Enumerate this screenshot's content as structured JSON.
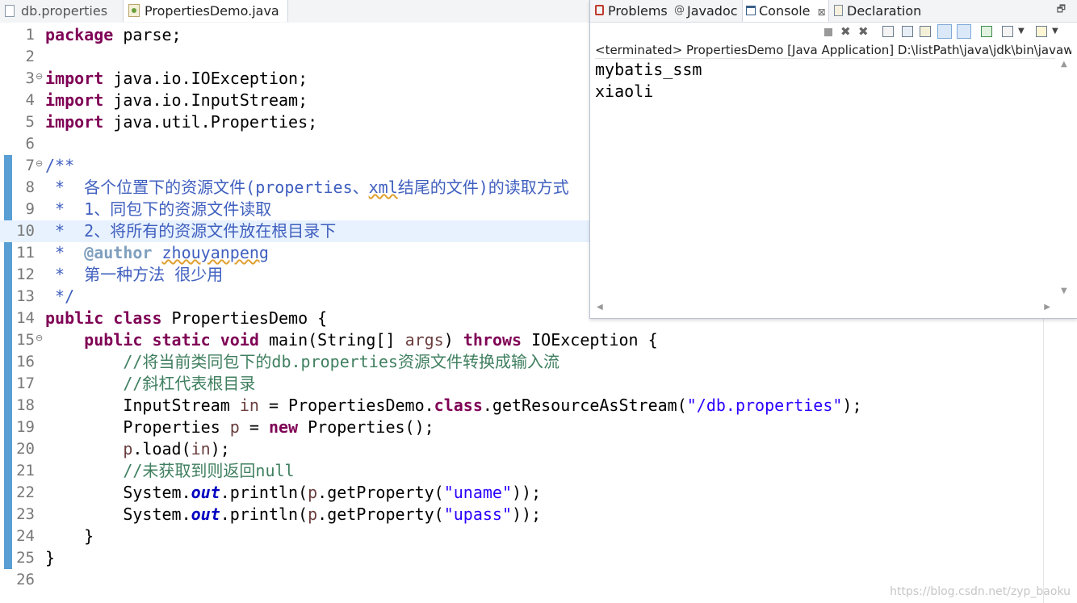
{
  "editor_tabs": [
    {
      "label": "db.properties",
      "active": false
    },
    {
      "label": "PropertiesDemo.java",
      "active": true,
      "close": "⊠"
    }
  ],
  "code": {
    "ln": [
      "1",
      "2",
      "3",
      "4",
      "5",
      "6",
      "7",
      "8",
      "9",
      "10",
      "11",
      "12",
      "13",
      "14",
      "15",
      "16",
      "17",
      "18",
      "19",
      "20",
      "21",
      "22",
      "23",
      "24",
      "25",
      "26"
    ],
    "l1": {
      "kw": "package",
      "rest": " parse;"
    },
    "l3": {
      "kw": "import",
      "rest": " java.io.IOException;"
    },
    "l4": {
      "kw": "import",
      "rest": " java.io.InputStream;"
    },
    "l5": {
      "kw": "import",
      "rest": " java.util.Properties;"
    },
    "l7": "/**",
    "l8": {
      "a": " *  各个位置下的资源文件(properties、",
      "b": "xml",
      "c": "结尾的文件)的读取方式"
    },
    "l9": " *  1、同包下的资源文件读取",
    "l10": " *  2、将所有的资源文件放在根目录下",
    "l11": {
      "a": " *  ",
      "tag": "@author",
      "sp": " ",
      "name": "zhouyanpeng"
    },
    "l12": " *  第一种方法 很少用",
    "l13": " */",
    "l14": {
      "kw1": "public",
      "s1": " ",
      "kw2": "class",
      "rest": " PropertiesDemo {"
    },
    "l15": {
      "ind": "    ",
      "kw1": "public",
      "s1": " ",
      "kw2": "static",
      "s2": " ",
      "kw3": "void",
      "m": " main(String[] ",
      "arg": "args",
      "s3": ") ",
      "kw4": "throws",
      "rest": " IOException {"
    },
    "l16": "        //将当前类同包下的db.properties资源文件转换成输入流",
    "l17": "        //斜杠代表根目录",
    "l18": {
      "a": "        InputStream ",
      "v": "in",
      "b": " = PropertiesDemo.",
      "kw": "class",
      "c": ".getResourceAsStream(",
      "str": "\"/db.properties\"",
      "d": ");"
    },
    "l19": {
      "a": "        Properties ",
      "v": "p",
      "b": " = ",
      "kw": "new",
      "c": " Properties();"
    },
    "l20": {
      "a": "        ",
      "v": "p",
      "b": ".load(",
      "v2": "in",
      "c": ");"
    },
    "l21": "        //未获取到则返回null",
    "l22": {
      "a": "        System.",
      "fld": "out",
      "b": ".println(",
      "v": "p",
      "c": ".getProperty(",
      "str": "\"uname\"",
      "d": "));"
    },
    "l23": {
      "a": "        System.",
      "fld": "out",
      "b": ".println(",
      "v": "p",
      "c": ".getProperty(",
      "str": "\"upass\"",
      "d": "));"
    },
    "l24": "    }",
    "l25": "}"
  },
  "console_panel": {
    "tabs": [
      {
        "label": "Problems"
      },
      {
        "label": "Javadoc"
      },
      {
        "label": "Console",
        "active": true,
        "close": "⊠"
      },
      {
        "label": "Declaration"
      }
    ],
    "status": "<terminated> PropertiesDemo [Java Application] D:\\listPath\\java\\jdk\\bin\\javaw.ex",
    "output": [
      "mybatis_ssm",
      "xiaoli"
    ]
  },
  "watermark": "https://blog.csdn.net/zyp_baoku",
  "colors": {
    "keyword": "#7f0055",
    "javadoc": "#3f5fbf",
    "comment": "#3f7f5f",
    "string": "#2a00ff",
    "field": "#0000c0"
  }
}
